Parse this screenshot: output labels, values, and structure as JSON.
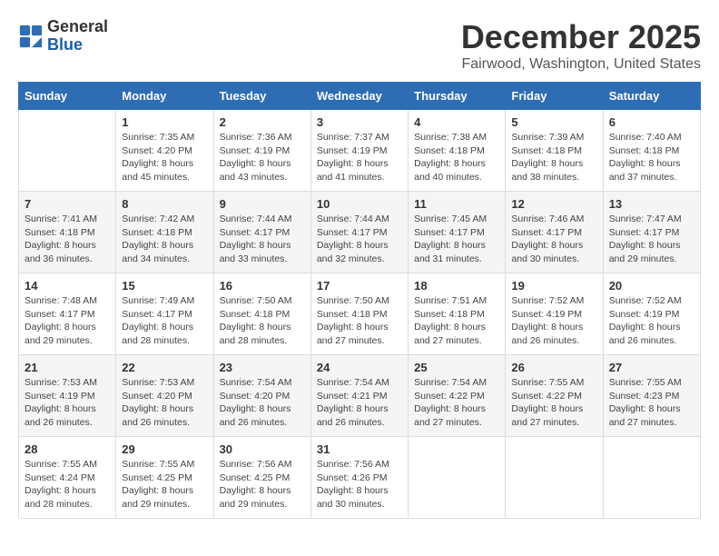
{
  "header": {
    "logo_line1": "General",
    "logo_line2": "Blue",
    "month": "December 2025",
    "location": "Fairwood, Washington, United States"
  },
  "weekdays": [
    "Sunday",
    "Monday",
    "Tuesday",
    "Wednesday",
    "Thursday",
    "Friday",
    "Saturday"
  ],
  "weeks": [
    [
      {
        "num": "",
        "sunrise": "",
        "sunset": "",
        "daylight": ""
      },
      {
        "num": "1",
        "sunrise": "Sunrise: 7:35 AM",
        "sunset": "Sunset: 4:20 PM",
        "daylight": "Daylight: 8 hours and 45 minutes."
      },
      {
        "num": "2",
        "sunrise": "Sunrise: 7:36 AM",
        "sunset": "Sunset: 4:19 PM",
        "daylight": "Daylight: 8 hours and 43 minutes."
      },
      {
        "num": "3",
        "sunrise": "Sunrise: 7:37 AM",
        "sunset": "Sunset: 4:19 PM",
        "daylight": "Daylight: 8 hours and 41 minutes."
      },
      {
        "num": "4",
        "sunrise": "Sunrise: 7:38 AM",
        "sunset": "Sunset: 4:18 PM",
        "daylight": "Daylight: 8 hours and 40 minutes."
      },
      {
        "num": "5",
        "sunrise": "Sunrise: 7:39 AM",
        "sunset": "Sunset: 4:18 PM",
        "daylight": "Daylight: 8 hours and 38 minutes."
      },
      {
        "num": "6",
        "sunrise": "Sunrise: 7:40 AM",
        "sunset": "Sunset: 4:18 PM",
        "daylight": "Daylight: 8 hours and 37 minutes."
      }
    ],
    [
      {
        "num": "7",
        "sunrise": "Sunrise: 7:41 AM",
        "sunset": "Sunset: 4:18 PM",
        "daylight": "Daylight: 8 hours and 36 minutes."
      },
      {
        "num": "8",
        "sunrise": "Sunrise: 7:42 AM",
        "sunset": "Sunset: 4:18 PM",
        "daylight": "Daylight: 8 hours and 34 minutes."
      },
      {
        "num": "9",
        "sunrise": "Sunrise: 7:44 AM",
        "sunset": "Sunset: 4:17 PM",
        "daylight": "Daylight: 8 hours and 33 minutes."
      },
      {
        "num": "10",
        "sunrise": "Sunrise: 7:44 AM",
        "sunset": "Sunset: 4:17 PM",
        "daylight": "Daylight: 8 hours and 32 minutes."
      },
      {
        "num": "11",
        "sunrise": "Sunrise: 7:45 AM",
        "sunset": "Sunset: 4:17 PM",
        "daylight": "Daylight: 8 hours and 31 minutes."
      },
      {
        "num": "12",
        "sunrise": "Sunrise: 7:46 AM",
        "sunset": "Sunset: 4:17 PM",
        "daylight": "Daylight: 8 hours and 30 minutes."
      },
      {
        "num": "13",
        "sunrise": "Sunrise: 7:47 AM",
        "sunset": "Sunset: 4:17 PM",
        "daylight": "Daylight: 8 hours and 29 minutes."
      }
    ],
    [
      {
        "num": "14",
        "sunrise": "Sunrise: 7:48 AM",
        "sunset": "Sunset: 4:17 PM",
        "daylight": "Daylight: 8 hours and 29 minutes."
      },
      {
        "num": "15",
        "sunrise": "Sunrise: 7:49 AM",
        "sunset": "Sunset: 4:17 PM",
        "daylight": "Daylight: 8 hours and 28 minutes."
      },
      {
        "num": "16",
        "sunrise": "Sunrise: 7:50 AM",
        "sunset": "Sunset: 4:18 PM",
        "daylight": "Daylight: 8 hours and 28 minutes."
      },
      {
        "num": "17",
        "sunrise": "Sunrise: 7:50 AM",
        "sunset": "Sunset: 4:18 PM",
        "daylight": "Daylight: 8 hours and 27 minutes."
      },
      {
        "num": "18",
        "sunrise": "Sunrise: 7:51 AM",
        "sunset": "Sunset: 4:18 PM",
        "daylight": "Daylight: 8 hours and 27 minutes."
      },
      {
        "num": "19",
        "sunrise": "Sunrise: 7:52 AM",
        "sunset": "Sunset: 4:19 PM",
        "daylight": "Daylight: 8 hours and 26 minutes."
      },
      {
        "num": "20",
        "sunrise": "Sunrise: 7:52 AM",
        "sunset": "Sunset: 4:19 PM",
        "daylight": "Daylight: 8 hours and 26 minutes."
      }
    ],
    [
      {
        "num": "21",
        "sunrise": "Sunrise: 7:53 AM",
        "sunset": "Sunset: 4:19 PM",
        "daylight": "Daylight: 8 hours and 26 minutes."
      },
      {
        "num": "22",
        "sunrise": "Sunrise: 7:53 AM",
        "sunset": "Sunset: 4:20 PM",
        "daylight": "Daylight: 8 hours and 26 minutes."
      },
      {
        "num": "23",
        "sunrise": "Sunrise: 7:54 AM",
        "sunset": "Sunset: 4:20 PM",
        "daylight": "Daylight: 8 hours and 26 minutes."
      },
      {
        "num": "24",
        "sunrise": "Sunrise: 7:54 AM",
        "sunset": "Sunset: 4:21 PM",
        "daylight": "Daylight: 8 hours and 26 minutes."
      },
      {
        "num": "25",
        "sunrise": "Sunrise: 7:54 AM",
        "sunset": "Sunset: 4:22 PM",
        "daylight": "Daylight: 8 hours and 27 minutes."
      },
      {
        "num": "26",
        "sunrise": "Sunrise: 7:55 AM",
        "sunset": "Sunset: 4:22 PM",
        "daylight": "Daylight: 8 hours and 27 minutes."
      },
      {
        "num": "27",
        "sunrise": "Sunrise: 7:55 AM",
        "sunset": "Sunset: 4:23 PM",
        "daylight": "Daylight: 8 hours and 27 minutes."
      }
    ],
    [
      {
        "num": "28",
        "sunrise": "Sunrise: 7:55 AM",
        "sunset": "Sunset: 4:24 PM",
        "daylight": "Daylight: 8 hours and 28 minutes."
      },
      {
        "num": "29",
        "sunrise": "Sunrise: 7:55 AM",
        "sunset": "Sunset: 4:25 PM",
        "daylight": "Daylight: 8 hours and 29 minutes."
      },
      {
        "num": "30",
        "sunrise": "Sunrise: 7:56 AM",
        "sunset": "Sunset: 4:25 PM",
        "daylight": "Daylight: 8 hours and 29 minutes."
      },
      {
        "num": "31",
        "sunrise": "Sunrise: 7:56 AM",
        "sunset": "Sunset: 4:26 PM",
        "daylight": "Daylight: 8 hours and 30 minutes."
      },
      {
        "num": "",
        "sunrise": "",
        "sunset": "",
        "daylight": ""
      },
      {
        "num": "",
        "sunrise": "",
        "sunset": "",
        "daylight": ""
      },
      {
        "num": "",
        "sunrise": "",
        "sunset": "",
        "daylight": ""
      }
    ]
  ]
}
